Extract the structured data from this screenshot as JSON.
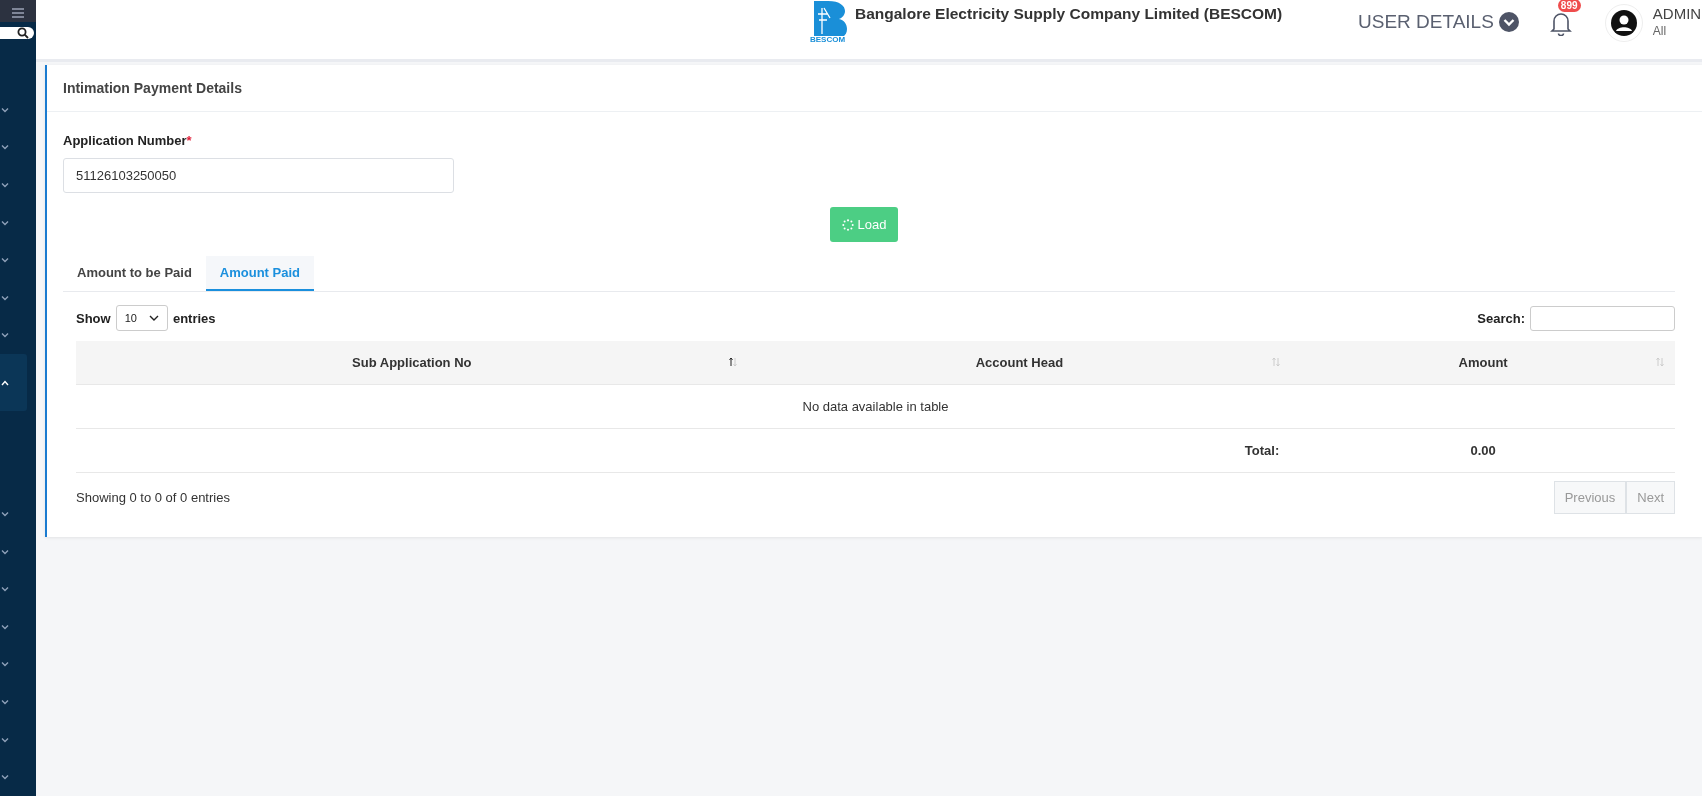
{
  "sidebar": {
    "items": [
      {
        "expanded": false
      },
      {
        "expanded": false
      },
      {
        "expanded": false
      },
      {
        "expanded": false
      },
      {
        "expanded": false
      },
      {
        "expanded": false
      },
      {
        "expanded": false
      },
      {
        "expanded": true
      },
      {
        "expanded": false
      },
      {
        "expanded": false
      },
      {
        "expanded": false
      },
      {
        "expanded": false
      },
      {
        "expanded": false
      },
      {
        "expanded": false
      },
      {
        "expanded": false
      },
      {
        "expanded": false
      }
    ]
  },
  "header": {
    "company": "Bangalore Electricity Supply Company Limited (BESCOM)",
    "logo_caption": "BESCOM",
    "user_details": "USER DETAILS",
    "notification_count": "899",
    "user_name": "ADMIN",
    "user_role": "All"
  },
  "card": {
    "title": "Intimation Payment Details",
    "field_label": "Application Number",
    "required_mark": "*",
    "field_value": "51126103250050",
    "load_button": "Load",
    "tabs": [
      {
        "label": "Amount to be Paid",
        "selected": false
      },
      {
        "label": "Amount Paid",
        "selected": true
      }
    ],
    "show_label": "Show",
    "page_size": "10",
    "entries_label": "entries",
    "search_label": "Search:",
    "table": {
      "columns": [
        {
          "label": "Sub Application No",
          "sorted": true
        },
        {
          "label": "Account Head",
          "sorted": false
        },
        {
          "label": "Amount",
          "sorted": false
        }
      ],
      "empty_message": "No data available in table",
      "total_label": "Total:",
      "total_value": "0.00"
    },
    "info": "Showing 0 to 0 of 0 entries",
    "pagination": [
      {
        "label": "Previous",
        "disabled": true
      },
      {
        "label": "Next",
        "disabled": true
      }
    ]
  }
}
